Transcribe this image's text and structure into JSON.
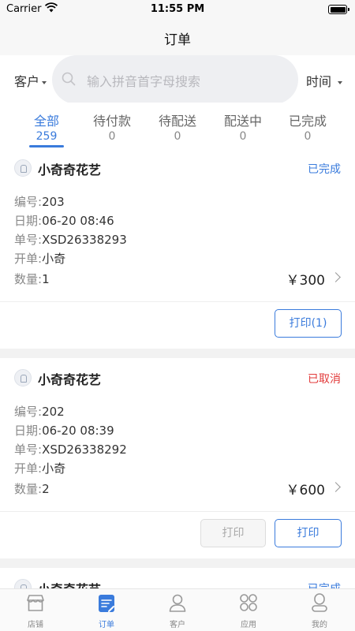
{
  "status_bar": {
    "carrier": "Carrier",
    "time": "11:55 PM"
  },
  "nav": {
    "title": "订单"
  },
  "filters": {
    "customer_label": "客户",
    "search_placeholder": "输入拼音首字母搜索",
    "time_label": "时间"
  },
  "tabs": [
    {
      "label": "全部",
      "count": "259"
    },
    {
      "label": "待付款",
      "count": "0"
    },
    {
      "label": "待配送",
      "count": "0"
    },
    {
      "label": "配送中",
      "count": "0"
    },
    {
      "label": "已完成",
      "count": "0"
    }
  ],
  "field_labels": {
    "number": "编号:",
    "date": "日期:",
    "order_no": "单号:",
    "opener": "开单:",
    "quantity": "数量:"
  },
  "orders": [
    {
      "shop": "小奇奇花艺",
      "status": "已完成",
      "number": "203",
      "date": "06-20 08:46",
      "order_no": "XSD26338293",
      "opener": "小奇",
      "quantity": "1",
      "price": "￥300",
      "print_label": "打印(1)"
    },
    {
      "shop": "小奇奇花艺",
      "status": "已取消",
      "number": "202",
      "date": "06-20 08:39",
      "order_no": "XSD26338292",
      "opener": "小奇",
      "quantity": "2",
      "price": "￥600",
      "print_disabled_label": "打印",
      "print_label": "打印"
    },
    {
      "shop": "小奇奇花艺",
      "status": "已完成"
    }
  ],
  "tab_bar": [
    {
      "label": "店铺",
      "icon": "store-icon"
    },
    {
      "label": "订单",
      "icon": "order-icon"
    },
    {
      "label": "客户",
      "icon": "customer-icon"
    },
    {
      "label": "应用",
      "icon": "apps-icon"
    },
    {
      "label": "我的",
      "icon": "profile-icon"
    }
  ],
  "colors": {
    "accent": "#3a7bdc",
    "cancel": "#e23b3b"
  }
}
